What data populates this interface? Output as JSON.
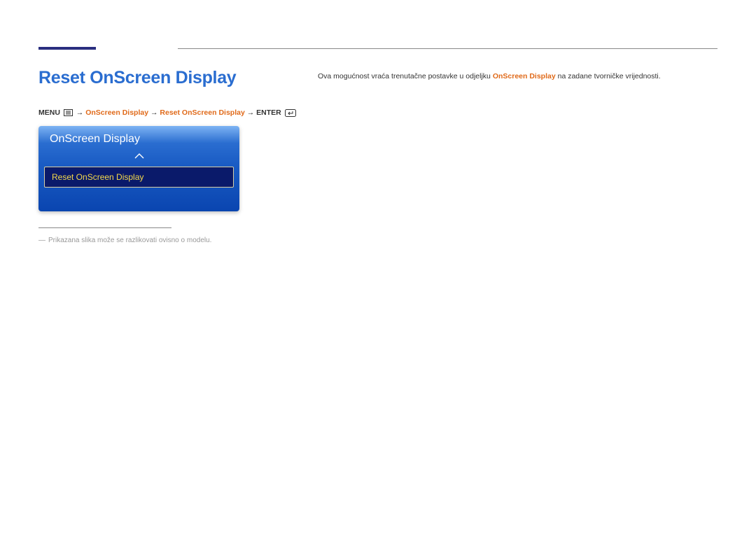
{
  "title": "Reset OnScreen Display",
  "breadcrumb": {
    "menu_label": "MENU",
    "p1": "OnScreen Display",
    "p2": "Reset OnScreen Display",
    "enter_label": "ENTER"
  },
  "osd": {
    "header": "OnScreen Display",
    "selected_item": "Reset OnScreen Display"
  },
  "body": {
    "before": "Ova mogućnost vraća trenutačne postavke u odjeljku ",
    "highlight": "OnScreen Display",
    "after": " na zadane tvorničke vrijednosti."
  },
  "footnote": "Prikazana slika može se razlikovati ovisno o modelu."
}
